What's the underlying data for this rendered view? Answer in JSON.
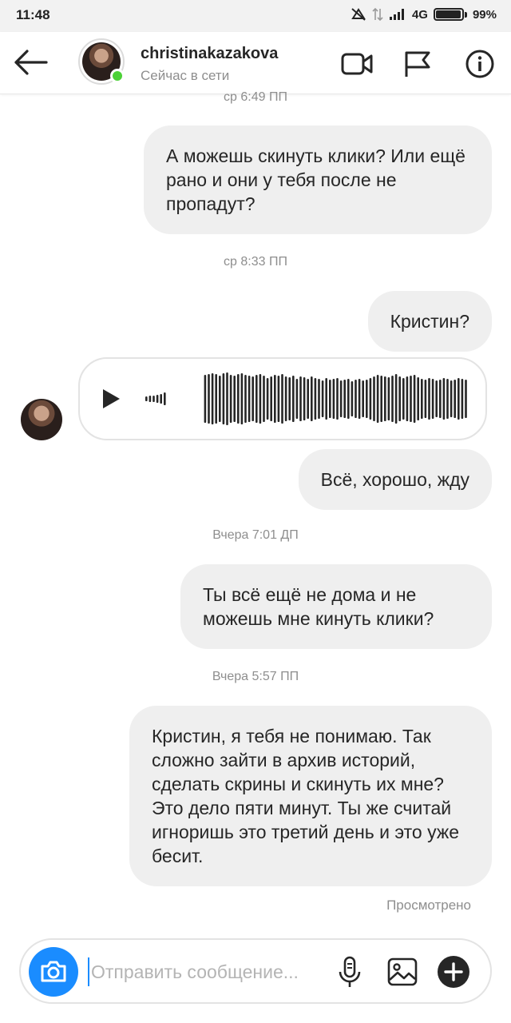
{
  "status_bar": {
    "time": "11:48",
    "network": "4G",
    "battery": "99%"
  },
  "header": {
    "username": "christinakazakova",
    "presence": "Сейчас в сети"
  },
  "messages": [
    {
      "type": "timestamp",
      "text": "ср 6:49 ПП"
    },
    {
      "type": "outgoing",
      "text": "А можешь скинуть клики? Или ещё рано и они у тебя после не пропадут?"
    },
    {
      "type": "timestamp",
      "text": "ср 8:33 ПП"
    },
    {
      "type": "outgoing",
      "text": "Кристин?"
    },
    {
      "type": "incoming_voice"
    },
    {
      "type": "outgoing",
      "text": "Всё, хорошо, жду"
    },
    {
      "type": "timestamp",
      "text": "Вчера 7:01 ДП"
    },
    {
      "type": "outgoing",
      "text": "Ты всё ещё не дома и не можешь мне кинуть клики?"
    },
    {
      "type": "timestamp",
      "text": "Вчера 5:57 ПП"
    },
    {
      "type": "outgoing",
      "text": "Кристин, я тебя не понимаю. Так сложно зайти в архив историй, сделать скрины и скинуть их мне? Это дело пяти минут. Ты же считай игноришь это третий день и это уже бесит."
    }
  ],
  "seen_label": "Просмотрено",
  "composer": {
    "placeholder": "Отправить сообщение..."
  },
  "colors": {
    "accent": "#1a8cff",
    "online": "#4cd137",
    "bubble": "#efefef"
  }
}
